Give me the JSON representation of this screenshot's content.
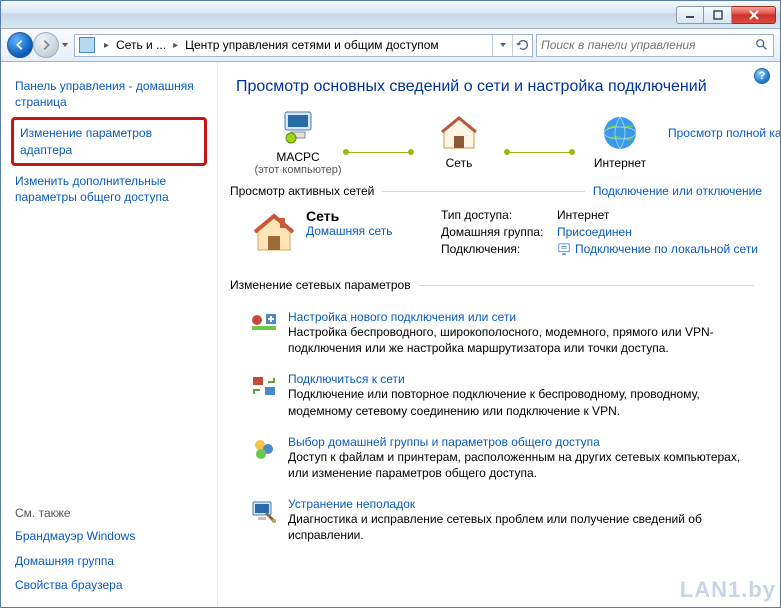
{
  "titlebar": {
    "min": "—",
    "max": "▢",
    "close": "✕"
  },
  "nav": {
    "crumb1": "Сеть и ...",
    "crumb2": "Центр управления сетями и общим доступом",
    "search_placeholder": "Поиск в панели управления"
  },
  "sidebar": {
    "home": "Панель управления - домашняя страница",
    "adapter": "Изменение параметров адаптера",
    "sharing": "Изменить дополнительные параметры общего доступа",
    "see_also": "См. также",
    "firewall": "Брандмауэр Windows",
    "homegroup": "Домашняя группа",
    "browser": "Свойства браузера"
  },
  "content": {
    "title": "Просмотр основных сведений о сети и настройка подключений",
    "map_full": "Просмотр полной карты",
    "node_pc": "MACPC",
    "node_pc_sub": "(этот компьютер)",
    "node_net": "Сеть",
    "node_inet": "Интернет",
    "active_hdr": "Просмотр активных сетей",
    "active_link": "Подключение или отключение",
    "net_name": "Сеть",
    "net_type": "Домашняя сеть",
    "k1": "Тип доступа:",
    "v1": "Интернет",
    "k2": "Домашняя группа:",
    "v2": "Присоединен",
    "k3": "Подключения:",
    "v3": "Подключение по локальной сети",
    "change_hdr": "Изменение сетевых параметров",
    "s1_title": "Настройка нового подключения или сети",
    "s1_desc": "Настройка беспроводного, широкополосного, модемного, прямого или VPN-подключения или же настройка маршрутизатора или точки доступа.",
    "s2_title": "Подключиться к сети",
    "s2_desc": "Подключение или повторное подключение к беспроводному, проводному, модемному сетевому соединению или подключение к VPN.",
    "s3_title": "Выбор домашней группы и параметров общего доступа",
    "s3_desc": "Доступ к файлам и принтерам, расположенным на других сетевых компьютерах, или изменение параметров общего доступа.",
    "s4_title": "Устранение неполадок",
    "s4_desc": "Диагностика и исправление сетевых проблем или получение сведений об исправлении.",
    "watermark": "LAN1.by"
  }
}
